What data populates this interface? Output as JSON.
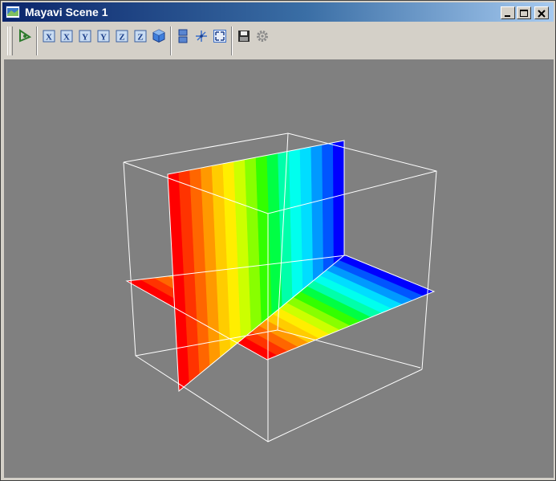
{
  "window": {
    "title": "Mayavi Scene 1"
  },
  "toolbar": {
    "buttons": [
      {
        "name": "rotate-pipeline-button",
        "icon": "pipeline-icon"
      },
      {
        "name": "view-x-positive-button",
        "icon": "axis-x-icon",
        "label": "X"
      },
      {
        "name": "view-x-negative-button",
        "icon": "axis-x-icon",
        "label": "X"
      },
      {
        "name": "view-y-positive-button",
        "icon": "axis-y-icon",
        "label": "Y"
      },
      {
        "name": "view-y-negative-button",
        "icon": "axis-y-icon",
        "label": "Y"
      },
      {
        "name": "view-z-positive-button",
        "icon": "axis-z-icon",
        "label": "Z"
      },
      {
        "name": "view-z-negative-button",
        "icon": "axis-z-icon",
        "label": "Z"
      },
      {
        "name": "isometric-view-button",
        "icon": "cube-icon"
      },
      {
        "name": "parallel-projection-button",
        "icon": "projection-icon"
      },
      {
        "name": "show-axes-button",
        "icon": "axes-icon"
      },
      {
        "name": "fullscreen-button",
        "icon": "fullscreen-icon"
      },
      {
        "name": "save-scene-button",
        "icon": "floppy-disk-icon"
      },
      {
        "name": "configure-scene-button",
        "icon": "gear-icon"
      }
    ]
  },
  "colors": {
    "titlebar_start": "#0a246a",
    "titlebar_end": "#a6caf0",
    "viewport_background": "#808080",
    "outline": "#ffffff",
    "colormap": [
      "#ff0000",
      "#ff3300",
      "#ff6600",
      "#ff9900",
      "#ffcc00",
      "#ffee00",
      "#ccff00",
      "#88ff00",
      "#33ff00",
      "#00ff44",
      "#00ffaa",
      "#00ffee",
      "#00ddff",
      "#0099ff",
      "#0055ff",
      "#0000ff"
    ]
  }
}
